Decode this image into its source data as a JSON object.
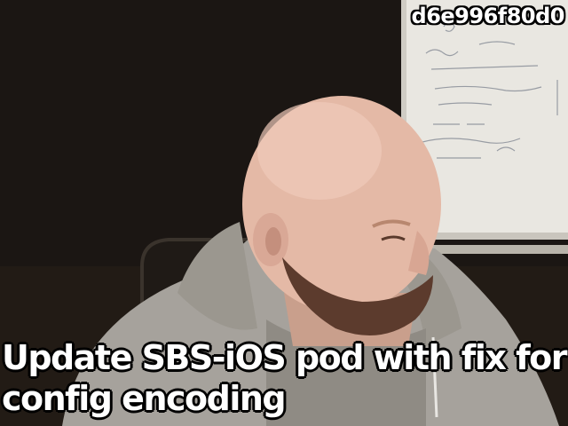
{
  "overlay": {
    "commit_id": "d6e996f80d0",
    "caption": "Update SBS-iOS pod with fix for config encoding"
  },
  "colors": {
    "background": "#1a1512",
    "whiteboard": "#eceae4",
    "hoodie": "#a9a59f",
    "skin": "#e2b6a3",
    "beard": "#5a3a2c",
    "text": "#ffffff",
    "text_outline": "#000000"
  }
}
